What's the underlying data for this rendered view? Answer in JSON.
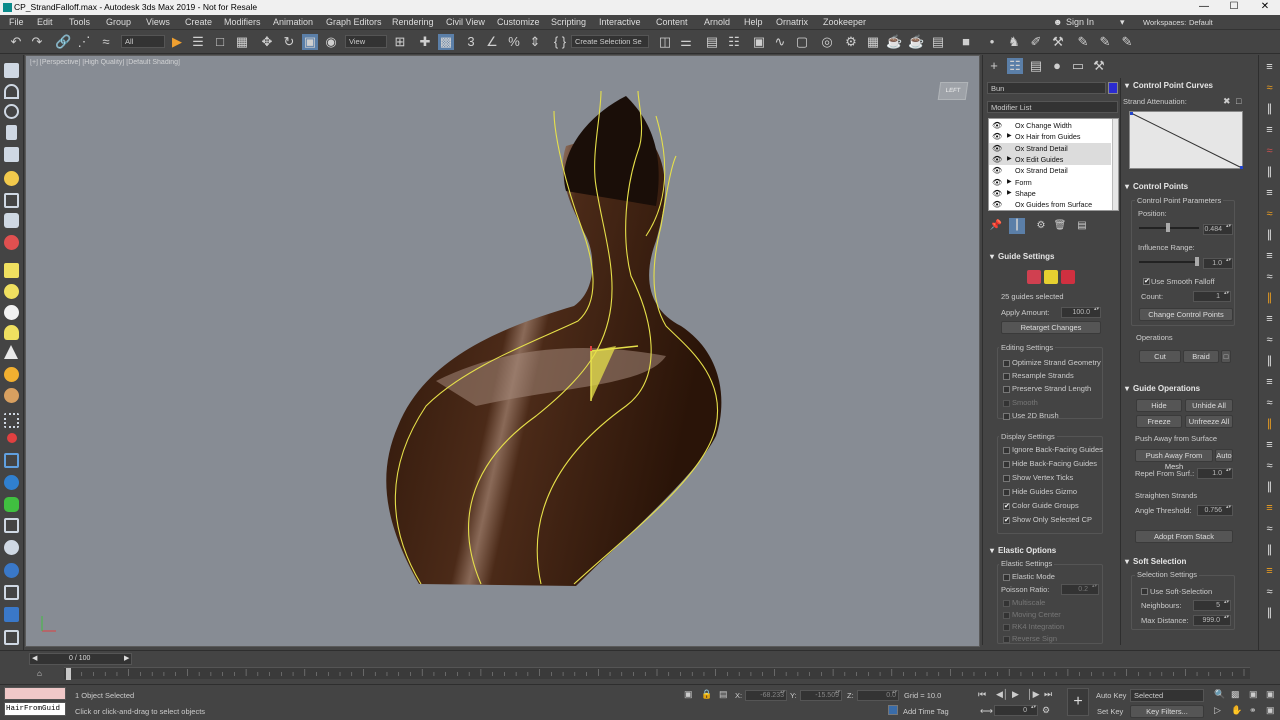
{
  "window": {
    "title": "CP_StrandFalloff.max - Autodesk 3ds Max 2019 - Not for Resale",
    "min": "—",
    "max": "☐",
    "close": "✕"
  },
  "menu": [
    "File",
    "Edit",
    "Tools",
    "Group",
    "Views",
    "Create",
    "Modifiers",
    "Animation",
    "Graph Editors",
    "Rendering",
    "Civil View",
    "Customize",
    "Scripting",
    "Interactive",
    "Content",
    "Arnold",
    "Help",
    "Ornatrix",
    "Zookeeper"
  ],
  "account": {
    "sign_in": "Sign In",
    "workspaces_label": "Workspaces:",
    "workspace": "Default"
  },
  "toolbar": {
    "filter": "All",
    "refcoord": "View",
    "selset": "Create Selection Se"
  },
  "viewport": {
    "label": "[+] [Perspective] [High Quality] [Default Shading]",
    "cube": "LEFT"
  },
  "object": {
    "name": "Bun",
    "color": "#2b2bd0"
  },
  "modifier_list": "Modifier List",
  "stack": [
    {
      "name": "Ox Change Width",
      "sel": false,
      "tri": false
    },
    {
      "name": "Ox Hair from Guides",
      "sel": false,
      "tri": true
    },
    {
      "name": "Ox Strand Detail",
      "sel": true,
      "tri": false
    },
    {
      "name": "Ox Edit Guides",
      "sel": true,
      "tri": true
    },
    {
      "name": "Ox Strand Detail",
      "sel": false,
      "tri": false
    },
    {
      "name": "Form",
      "sel": false,
      "tri": true
    },
    {
      "name": "Shape",
      "sel": false,
      "tri": true
    },
    {
      "name": "Ox Guides from Surface",
      "sel": false,
      "tri": false
    }
  ],
  "guide_settings": {
    "title": "Guide Settings",
    "selected": "25 guides selected",
    "apply_label": "Apply Amount:",
    "apply_value": "100.0",
    "retarget": "Retarget Changes",
    "editing_title": "Editing Settings",
    "editing": [
      {
        "label": "Optimize Strand Geometry",
        "on": false,
        "dim": false
      },
      {
        "label": "Resample Strands",
        "on": false,
        "dim": false
      },
      {
        "label": "Preserve Strand Length",
        "on": false,
        "dim": false
      },
      {
        "label": "Smooth",
        "on": false,
        "dim": true
      },
      {
        "label": "Use 2D Brush",
        "on": false,
        "dim": false
      }
    ],
    "display_title": "Display Settings",
    "display": [
      {
        "label": "Ignore Back-Facing Guides",
        "on": false
      },
      {
        "label": "Hide Back-Facing Guides",
        "on": false
      },
      {
        "label": "Show Vertex Ticks",
        "on": false
      },
      {
        "label": "Hide Guides Gizmo",
        "on": false
      },
      {
        "label": "Color Guide Groups",
        "on": true
      },
      {
        "label": "Show Only Selected CP",
        "on": true
      }
    ]
  },
  "elastic": {
    "title": "Elastic Options",
    "settings": "Elastic Settings",
    "mode": "Elastic Mode",
    "poisson_label": "Poisson Ratio:",
    "poisson_value": "0.2",
    "dim_items": [
      "Multiscale",
      "Moving Center",
      "RK4 Integration",
      "Reverse Sign"
    ]
  },
  "cp_curves": {
    "title": "Control Point Curves",
    "attenuation": "Strand Attenuation:"
  },
  "control_points": {
    "title": "Control Points",
    "params": "Control Point Parameters",
    "position_label": "Position:",
    "position": 0.484,
    "position_text": "0.484",
    "influence_label": "Influence Range:",
    "influence": 1.0,
    "influence_text": "1.0",
    "smooth": "Use Smooth Falloff",
    "count_label": "Count:",
    "count": "1",
    "change_btn": "Change Control Points",
    "operations": "Operations",
    "cut": "Cut",
    "braid": "Braid"
  },
  "guide_ops": {
    "title": "Guide Operations",
    "hide": "Hide",
    "unhide": "Unhide All",
    "freeze": "Freeze",
    "unfreeze": "Unfreeze All",
    "push_title": "Push Away from Surface",
    "push_btn": "Push Away From Mesh",
    "auto": "Auto",
    "repel_label": "Repel From Surf.:",
    "repel_value": "1.0",
    "straighten_title": "Straighten Strands",
    "angle_label": "Angle Threshold:",
    "angle_value": "0.756",
    "adopt": "Adopt From Stack"
  },
  "soft_selection": {
    "title": "Soft Selection",
    "settings": "Selection Settings",
    "use": "Use Soft-Selection",
    "neighbours_label": "Neighbours:",
    "neighbours": "5",
    "maxdist_label": "Max Distance:",
    "maxdist": "999.0"
  },
  "timeline": {
    "frame": "0 / 100",
    "ticks": [
      "0",
      "5",
      "10",
      "15",
      "20",
      "25",
      "30",
      "35",
      "40",
      "45",
      "50",
      "55",
      "60",
      "65",
      "70",
      "75",
      "80",
      "85",
      "90",
      "95",
      "100"
    ]
  },
  "status": {
    "maxscript": "HairFromGuid",
    "selected": "1 Object Selected",
    "prompt": "Click or click-and-drag to select objects",
    "x_label": "X:",
    "x": "-68.233",
    "y_label": "Y:",
    "y": "-15.509",
    "z_label": "Z:",
    "z": "0.0",
    "grid": "Grid = 10.0",
    "add_time_tag": "Add Time Tag",
    "auto_key": "Auto Key",
    "set_key": "Set Key",
    "key_mode": "Selected",
    "key_filters": "Key Filters...",
    "frame": "0"
  }
}
